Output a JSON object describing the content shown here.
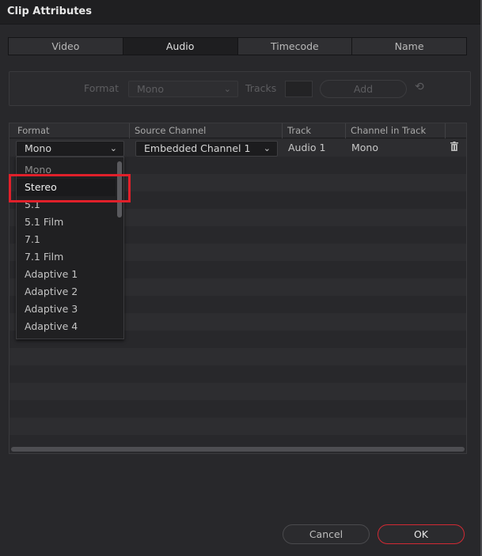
{
  "window": {
    "title": "Clip Attributes"
  },
  "tabs": [
    {
      "label": "Video"
    },
    {
      "label": "Audio"
    },
    {
      "label": "Timecode"
    },
    {
      "label": "Name"
    }
  ],
  "active_tab": "Audio",
  "format_bar": {
    "format_label": "Format",
    "format_value": "Mono",
    "tracks_label": "Tracks",
    "tracks_value": "",
    "add_label": "Add"
  },
  "table": {
    "columns": [
      "Format",
      "Source Channel",
      "Track",
      "Channel in Track"
    ],
    "rows": [
      {
        "format": "Mono",
        "source_channel": "Embedded Channel 1",
        "track": "Audio 1",
        "channel_in_track": "Mono"
      }
    ]
  },
  "dropdown": {
    "options": [
      "Mono",
      "Stereo",
      "5.1",
      "5.1 Film",
      "7.1",
      "7.1 Film",
      "Adaptive 1",
      "Adaptive 2",
      "Adaptive 3",
      "Adaptive 4"
    ],
    "hovered": "Stereo",
    "selected": "Mono"
  },
  "buttons": {
    "cancel": "Cancel",
    "ok": "OK"
  },
  "colors": {
    "highlight": "#e0202a",
    "ok_border": "#d22a34",
    "background": "#28282b"
  }
}
